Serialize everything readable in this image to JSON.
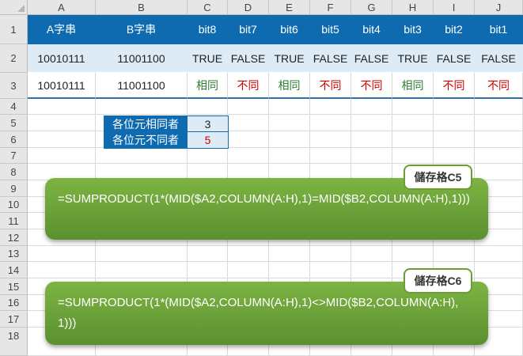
{
  "columns": [
    "A",
    "B",
    "C",
    "D",
    "E",
    "F",
    "G",
    "H",
    "I",
    "J"
  ],
  "rows": [
    "1",
    "2",
    "3",
    "4",
    "5",
    "6",
    "7",
    "8",
    "9",
    "10",
    "11",
    "12",
    "13",
    "14",
    "15",
    "16",
    "17",
    "18"
  ],
  "header_row": [
    "A字串",
    "B字串",
    "bit8",
    "bit7",
    "bit6",
    "bit5",
    "bit4",
    "bit3",
    "bit2",
    "bit1"
  ],
  "row2": [
    "10010111",
    "11001100",
    "TRUE",
    "FALSE",
    "TRUE",
    "FALSE",
    "FALSE",
    "TRUE",
    "FALSE",
    "FALSE"
  ],
  "row3": [
    "10010111",
    "11001100",
    "相同",
    "不同",
    "相同",
    "不同",
    "不同",
    "相同",
    "不同",
    "不同"
  ],
  "summary": {
    "same_label": "各位元相同者",
    "same_value": "3",
    "diff_label": "各位元不同者",
    "diff_value": "5"
  },
  "callouts": [
    {
      "tag": "儲存格C5",
      "formula": "=SUMPRODUCT(1*(MID($A2,COLUMN(A:H),1)=MID($B2,COLUMN(A:H),1)))"
    },
    {
      "tag": "儲存格C6",
      "formula": "=SUMPRODUCT(1*(MID($A2,COLUMN(A:H),1)<>MID($B2,COLUMN(A:H),1)))"
    }
  ],
  "colors": {
    "header_blue": "#0e6bb0",
    "light_blue": "#ddebf7",
    "green_callout": "#6a9d34",
    "same_green": "#2e7d32",
    "diff_red": "#d00000"
  }
}
